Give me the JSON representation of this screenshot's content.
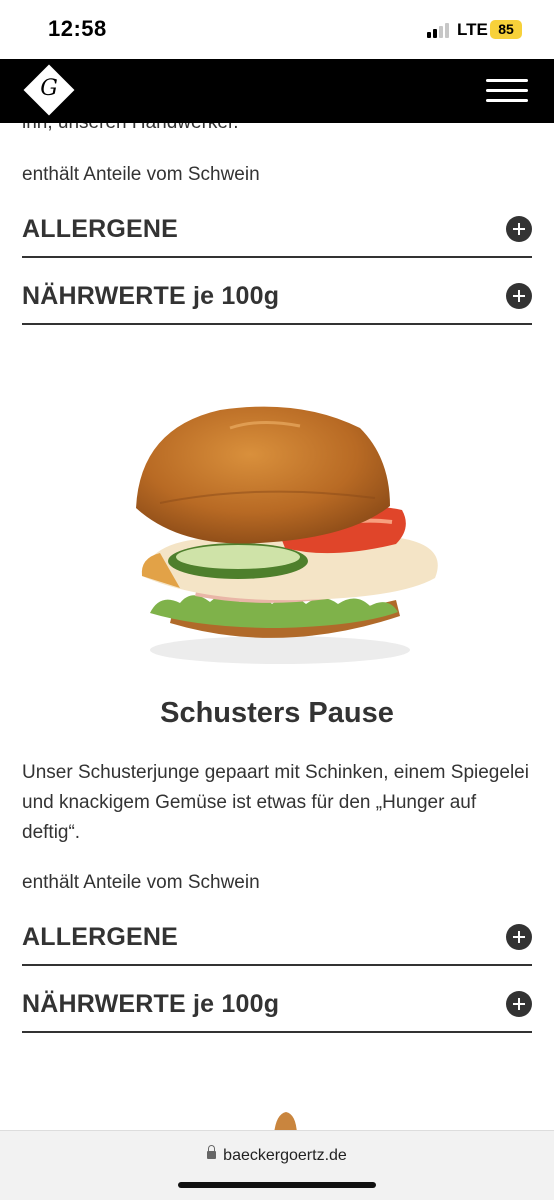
{
  "status_bar": {
    "time": "12:58",
    "network": "LTE",
    "battery": "85"
  },
  "header": {
    "logo_letter": "G"
  },
  "previous_product": {
    "clipped_text": "inn, unseren Handwerker.",
    "contains": "enthält Anteile vom Schwein",
    "allergens_label": "ALLERGENE",
    "nutrition_label": "NÄHRWERTE je 100g"
  },
  "product": {
    "title": "Schusters Pause",
    "description": "Unser Schusterjunge gepaart mit Schinken, einem Spiegelei und knackigem Gemüse ist etwas für den „Hunger auf deftig“.",
    "contains": "enthält Anteile vom Schwein",
    "allergens_label": "ALLERGENE",
    "nutrition_label": "NÄHRWERTE je 100g"
  },
  "browser": {
    "url": "baeckergoertz.de"
  },
  "colors": {
    "text": "#333333",
    "header_bg": "#000000",
    "battery": "#f7d13a"
  }
}
